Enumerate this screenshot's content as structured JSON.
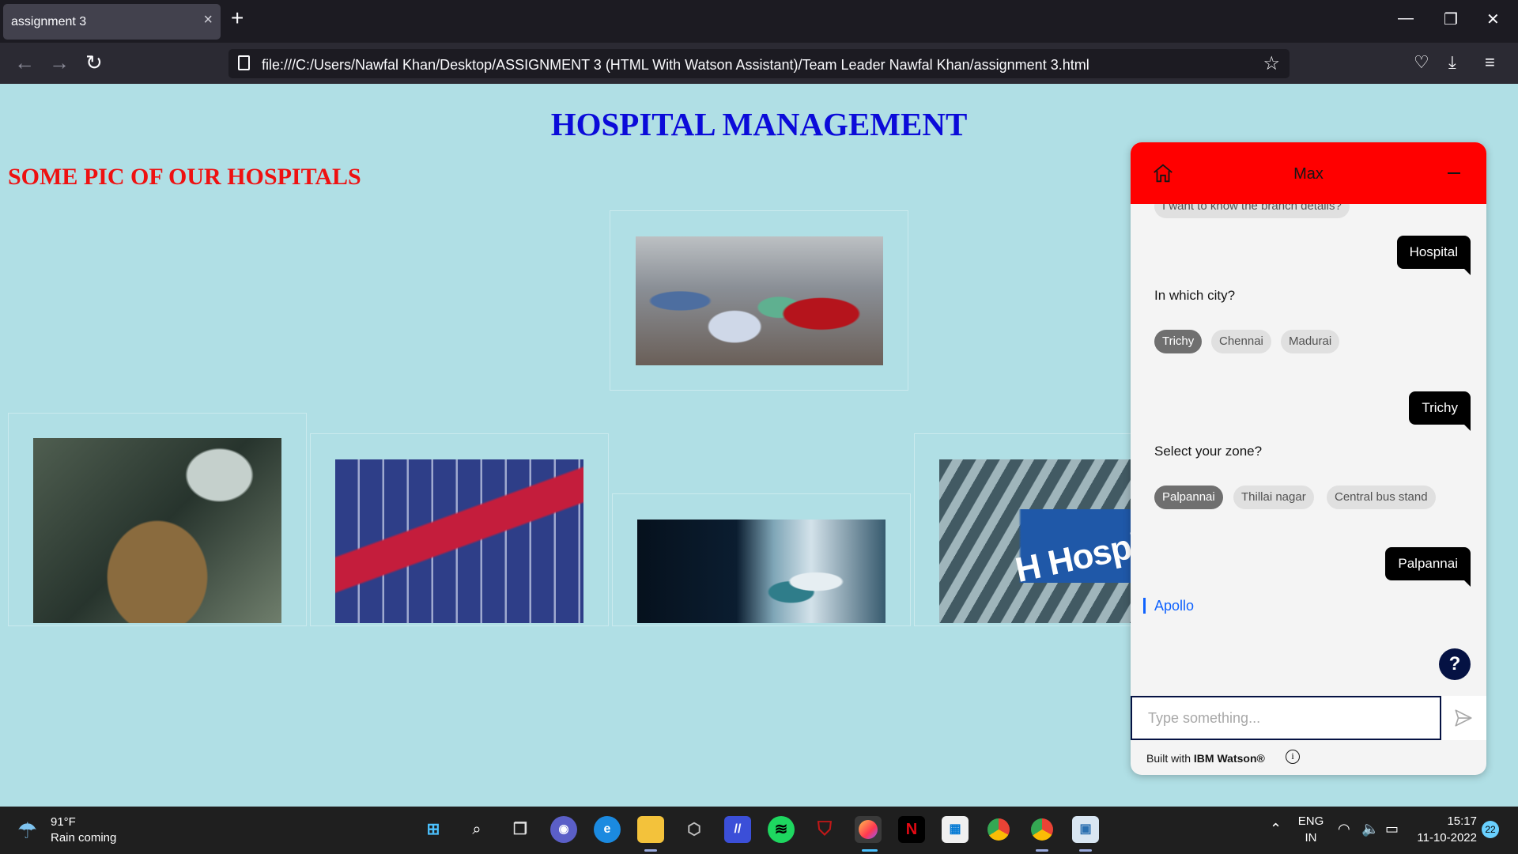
{
  "browser": {
    "tab_title": "assignment 3",
    "tab_close": "×",
    "new_tab": "+",
    "url": "file:///C:/Users/Nawfal Khan/Desktop/ASSIGNMENT 3 (HTML With Watson Assistant)/Team Leader Nawfal Khan/assignment 3.html"
  },
  "page": {
    "title": "HOSPITAL MANAGEMENT",
    "subtitle": "SOME PIC OF OUR HOSPITALS",
    "hospital_sign_text": "H Hospital"
  },
  "chat": {
    "assistant_name": "Max",
    "partial_chip": "I want to know the branch details?",
    "messages": {
      "user_hospital": "Hospital",
      "bot_city_question": "In which city?",
      "city_options": [
        "Trichy",
        "Chennai",
        "Madurai"
      ],
      "user_city": "Trichy",
      "bot_zone_question": "Select your zone?",
      "zone_options": [
        "Palpannai",
        "Thillai nagar",
        "Central bus stand"
      ],
      "user_zone": "Palpannai",
      "bot_link": "Apollo"
    },
    "help_label": "?",
    "input_placeholder": "Type something...",
    "footer_prefix": "Built with ",
    "footer_brand": "IBM Watson®",
    "info_label": "i"
  },
  "taskbar": {
    "weather_temp": "91°F",
    "weather_desc": "Rain coming",
    "language": "ENG",
    "region": "IN",
    "time": "15:17",
    "date": "11-10-2022",
    "notifications": "22"
  },
  "colors": {
    "page_bg": "#b0dfe5",
    "title": "#0b0bd9",
    "subtitle": "#ee1111",
    "chat_header": "#ff0000",
    "user_bubble": "#000000",
    "link": "#0f62fe"
  }
}
